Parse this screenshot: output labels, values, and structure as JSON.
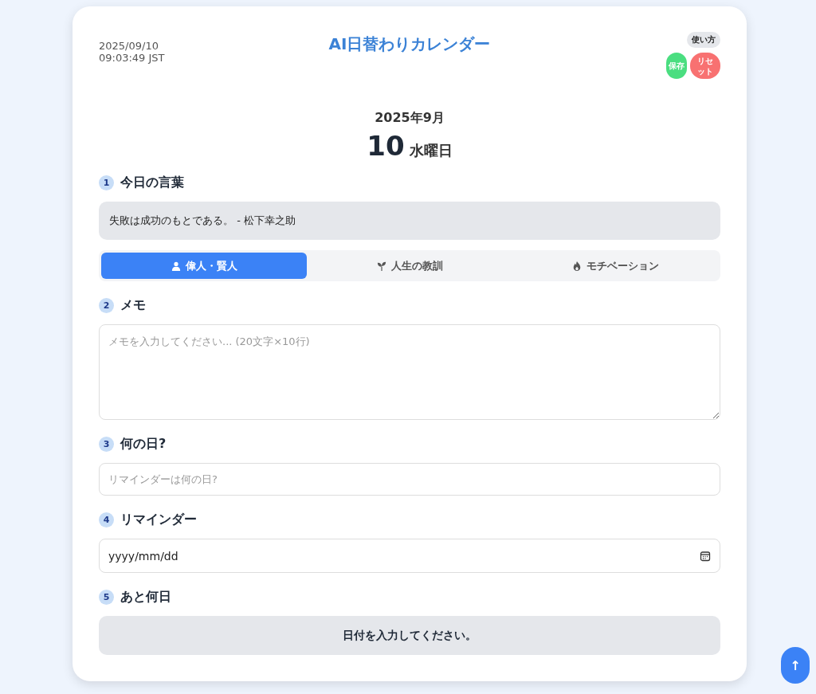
{
  "header": {
    "date": "2025/09/10",
    "time": "09:03:49 JST",
    "title": "AI日替わりカレンダー",
    "help_button": "使い方",
    "save_button": "保存",
    "reset_button": "リセット"
  },
  "calendar": {
    "month": "2025年9月",
    "day": "10",
    "weekday": "水曜日"
  },
  "quote_section": {
    "number": "1",
    "label": "今日の言葉",
    "quote": "失敗は成功のもとである。 - 松下幸之助",
    "tabs": [
      {
        "kind": "person",
        "label": "偉人・賢人",
        "selected": true
      },
      {
        "kind": "sprout",
        "label": "人生の教訓",
        "selected": false
      },
      {
        "kind": "flame",
        "label": "モチベーション",
        "selected": false
      }
    ]
  },
  "memo_section": {
    "number": "2",
    "label": "メモ",
    "placeholder": "メモを入力してください... (20文字×10行)"
  },
  "day_section": {
    "number": "3",
    "label": "何の日?",
    "placeholder": "リマインダーは何の日?"
  },
  "reminder_section": {
    "number": "4",
    "label": "リマインダー",
    "placeholder": "yyyy/mm/dd"
  },
  "countdown_section": {
    "number": "5",
    "label": "あと何日",
    "result": "日付を入力してください。"
  },
  "scroll_top_button": {
    "label": "↑"
  }
}
